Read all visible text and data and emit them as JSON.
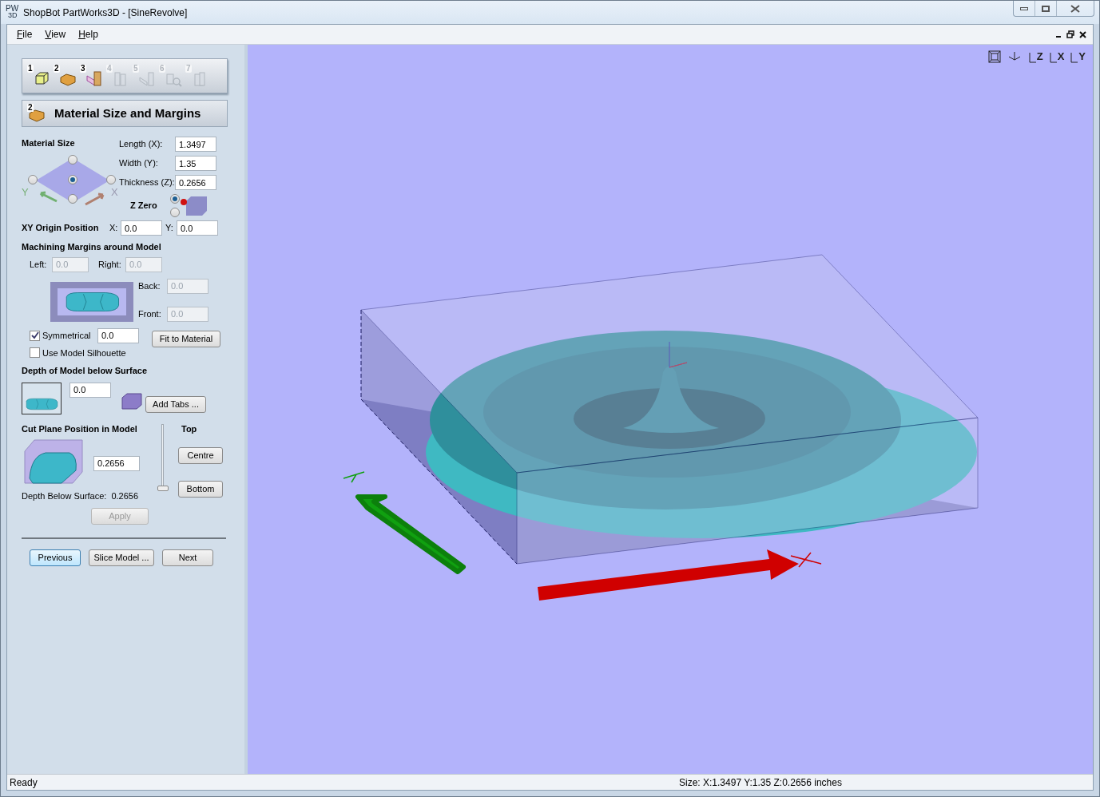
{
  "window": {
    "title": "ShopBot PartWorks3D - [SineRevolve]",
    "app_icon": {
      "top": "PW",
      "bottom": "3D"
    }
  },
  "menu": [
    {
      "mnemonic": "F",
      "rest": "ile"
    },
    {
      "mnemonic": "V",
      "rest": "iew"
    },
    {
      "mnemonic": "H",
      "rest": "elp"
    }
  ],
  "steps": [
    {
      "number": "1",
      "kind": "box",
      "enabled": true
    },
    {
      "number": "2",
      "kind": "block",
      "enabled": true
    },
    {
      "number": "3",
      "kind": "slab",
      "enabled": true
    },
    {
      "number": "4",
      "kind": "layers",
      "enabled": false
    },
    {
      "number": "5",
      "kind": "slice",
      "enabled": false
    },
    {
      "number": "6",
      "kind": "zoom",
      "enabled": false
    },
    {
      "number": "7",
      "kind": "stack",
      "enabled": false
    }
  ],
  "panel_title": {
    "step": "2",
    "text": "Material Size and Margins"
  },
  "material_size": {
    "heading": "Material Size",
    "fields": [
      {
        "label": "Length (X):",
        "value": "1.3497"
      },
      {
        "label": "Width (Y):",
        "value": "1.35"
      },
      {
        "label": "Thickness (Z):",
        "value": "0.2656"
      }
    ],
    "origin_radios": [
      {
        "kind": "top",
        "selected": false
      },
      {
        "kind": "left",
        "selected": false
      },
      {
        "kind": "center",
        "selected": true
      },
      {
        "kind": "right",
        "selected": false
      },
      {
        "kind": "bottom",
        "selected": false
      }
    ],
    "axis_y": "Y",
    "axis_x": "X",
    "z_zero": {
      "label": "Z Zero",
      "options": [
        {
          "selected": true
        },
        {
          "selected": false
        }
      ]
    }
  },
  "xy_origin": {
    "label": "XY Origin Position",
    "x": {
      "label": "X:",
      "value": "0.0"
    },
    "y": {
      "label": "Y:",
      "value": "0.0"
    }
  },
  "margins": {
    "heading": "Machining Margins around Model",
    "left": {
      "label": "Left:",
      "value": "0.0",
      "disabled": true
    },
    "right": {
      "label": "Right:",
      "value": "0.0",
      "disabled": true
    },
    "back": {
      "label": "Back:",
      "value": "0.0",
      "disabled": true
    },
    "front": {
      "label": "Front:",
      "value": "0.0",
      "disabled": true
    },
    "symmetrical": {
      "label": "Symmetrical",
      "checked": true,
      "value": "0.0"
    },
    "silhouette": {
      "label": "Use Model Silhouette",
      "checked": false
    },
    "fit_button": "Fit to Material"
  },
  "depth": {
    "heading": "Depth of Model below Surface",
    "value": "0.0",
    "add_tabs": "Add Tabs ..."
  },
  "cut_plane": {
    "heading": "Cut Plane Position in Model",
    "value": "0.2656",
    "top_label": "Top",
    "centre": "Centre",
    "bottom": "Bottom",
    "depth_label": "Depth Below Surface:",
    "depth_value": "0.2656",
    "level": 0,
    "apply": {
      "label": "Apply",
      "disabled": true
    }
  },
  "nav": [
    {
      "label": "Previous",
      "focused": true
    },
    {
      "label": "Slice Model ...",
      "focused": false
    },
    {
      "label": "Next",
      "focused": false
    }
  ],
  "view_buttons": [
    {
      "kind": "fit"
    },
    {
      "kind": "iso"
    },
    {
      "kind": "axis",
      "label": "Z"
    },
    {
      "kind": "axis",
      "label": "X"
    },
    {
      "kind": "axis",
      "label": "Y"
    }
  ],
  "status_bar": {
    "left": "Ready",
    "right": "Size: X:1.3497 Y:1.35 Z:0.2656 inches"
  }
}
